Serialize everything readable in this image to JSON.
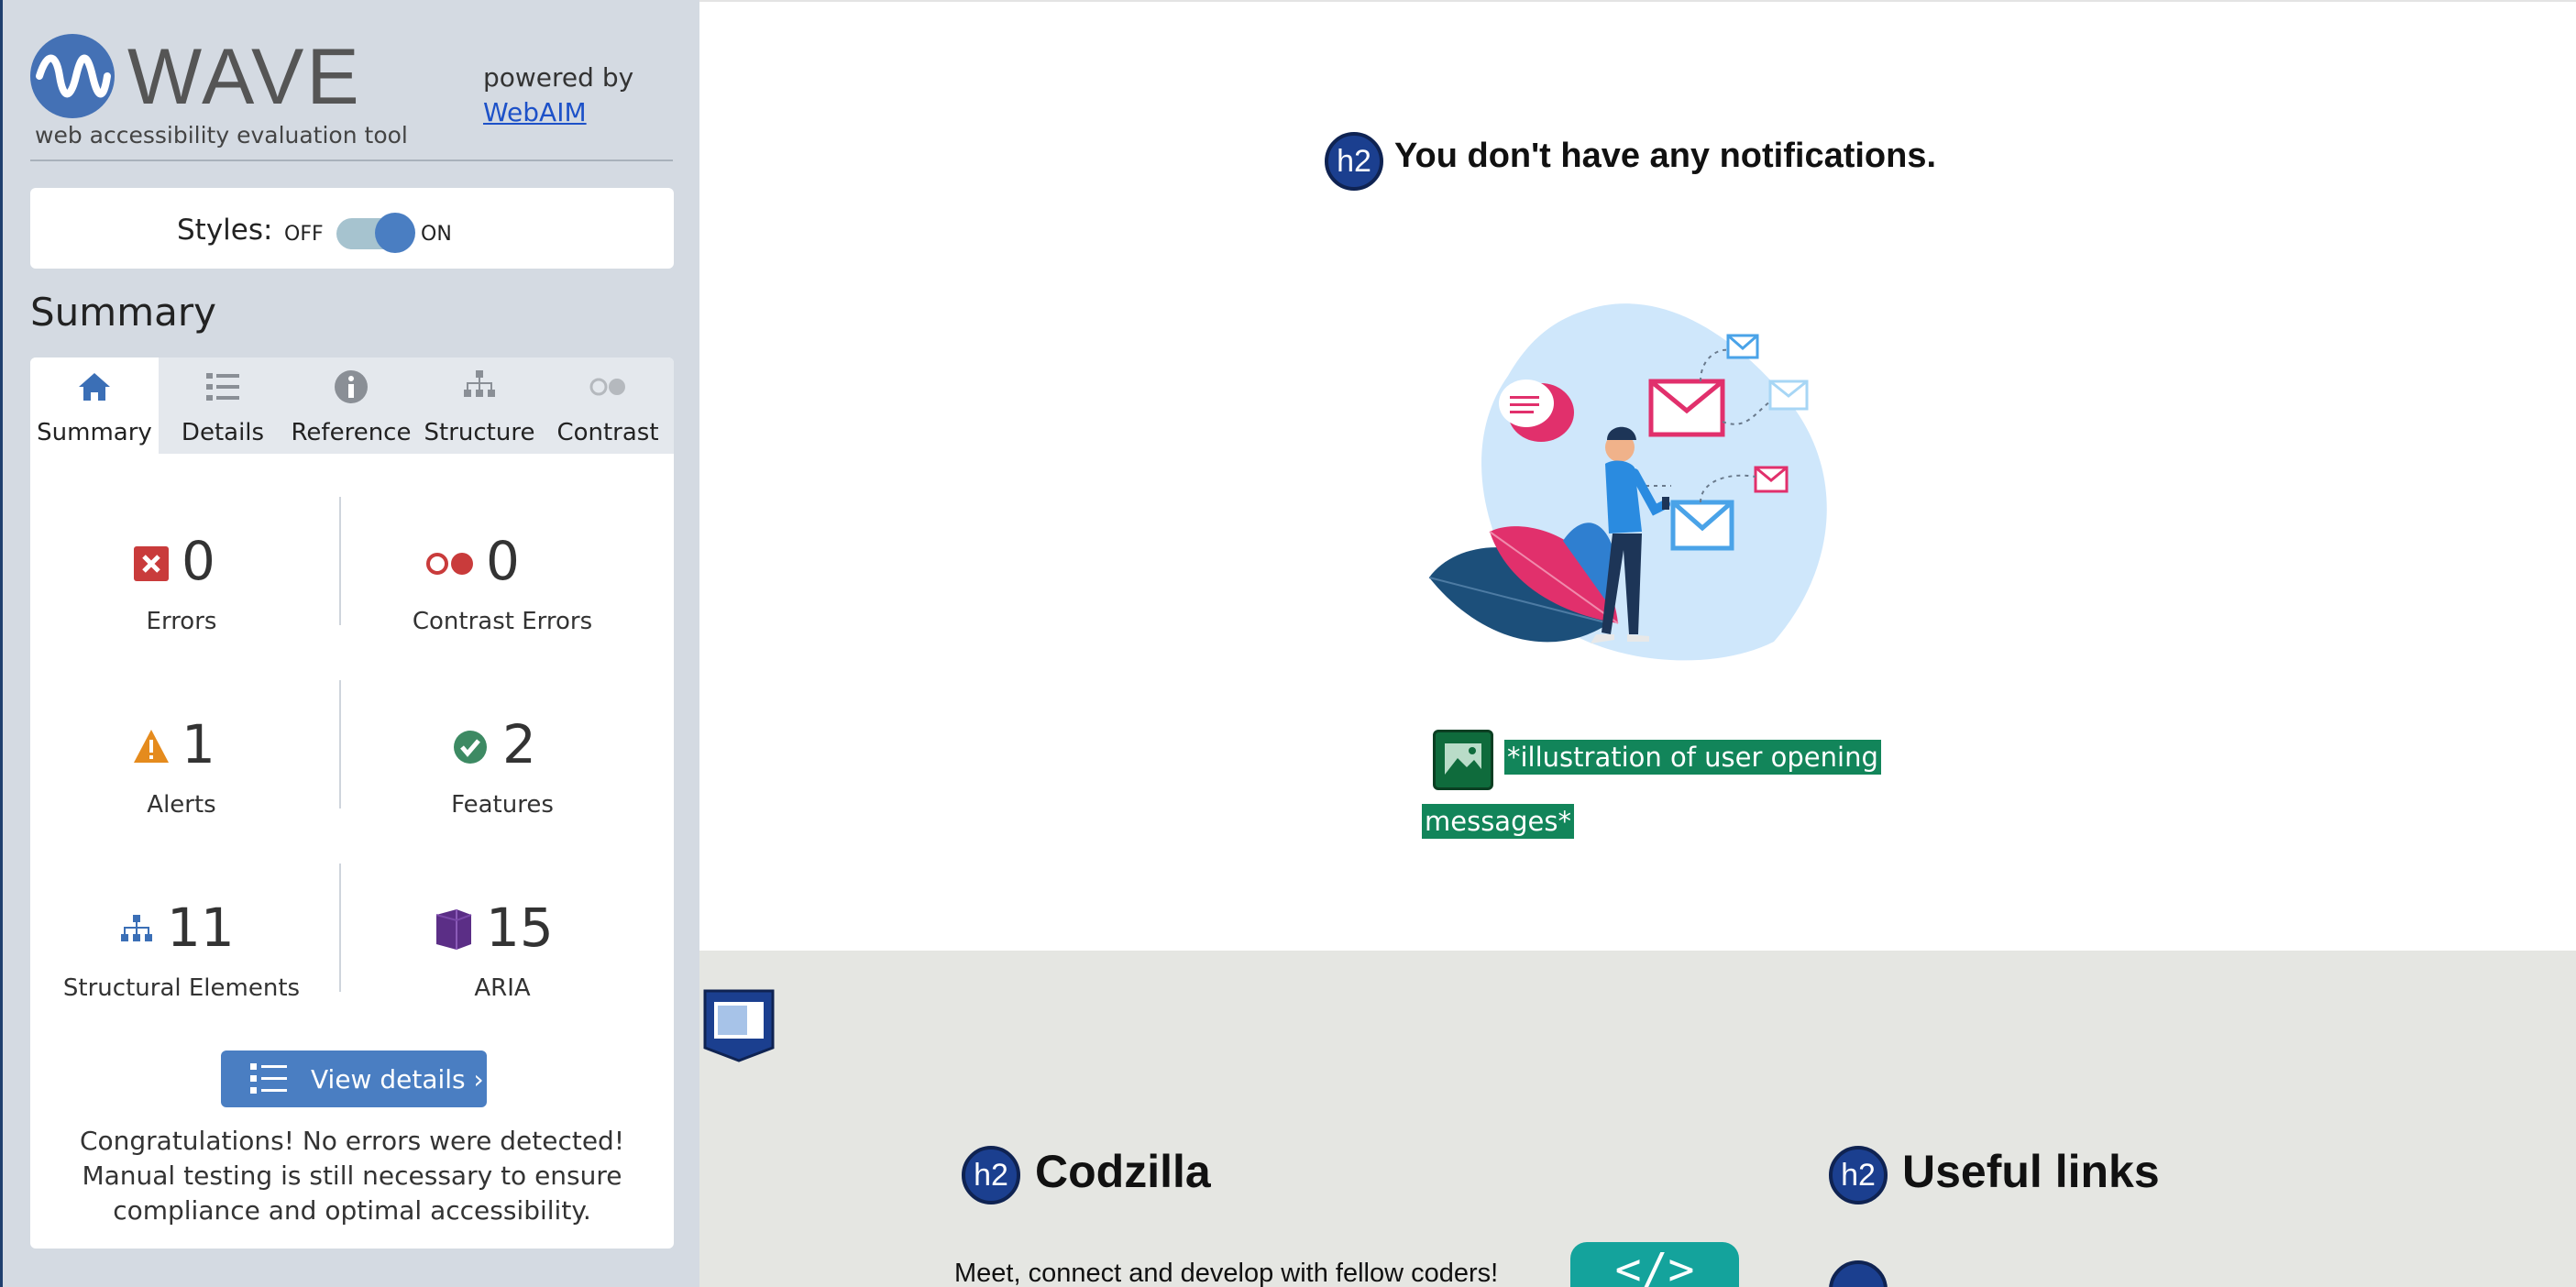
{
  "wave": {
    "logo_word": "WAVE",
    "tagline": "web accessibility evaluation tool",
    "powered_by": "powered by",
    "webaim_link": "WebAIM",
    "styles_label": "Styles:",
    "styles_off": "OFF",
    "styles_on": "ON",
    "styles_state": "on",
    "summary_title": "Summary",
    "tabs": [
      {
        "label": "Summary",
        "icon": "home-icon",
        "active": true
      },
      {
        "label": "Details",
        "icon": "list-icon",
        "active": false
      },
      {
        "label": "Reference",
        "icon": "info-icon",
        "active": false
      },
      {
        "label": "Structure",
        "icon": "structure-icon",
        "active": false
      },
      {
        "label": "Contrast",
        "icon": "contrast-icon",
        "active": false
      }
    ],
    "stats": {
      "errors": {
        "count": "0",
        "label": "Errors",
        "icon": "error-icon",
        "color": "#c93b3b"
      },
      "contrast_errors": {
        "count": "0",
        "label": "Contrast Errors",
        "icon": "contrast-error-icon",
        "color": "#c93b3b"
      },
      "alerts": {
        "count": "1",
        "label": "Alerts",
        "icon": "alert-icon",
        "color": "#e58b1d"
      },
      "features": {
        "count": "2",
        "label": "Features",
        "icon": "feature-icon",
        "color": "#3d8a63"
      },
      "structural": {
        "count": "11",
        "label": "Structural Elements",
        "icon": "structure-icon",
        "color": "#3b6fb6"
      },
      "aria": {
        "count": "15",
        "label": "ARIA",
        "icon": "aria-icon",
        "color": "#5b2e86"
      }
    },
    "view_details": "View details ›",
    "congrats": "Congratulations! No errors were detected! Manual testing is still necessary to ensure compliance and optimal accessibility."
  },
  "page": {
    "h2_badge": "h2",
    "notifications_heading": "You don't have any notifications.",
    "alt_text_line1": "*illustration of user opening",
    "alt_text_line2": "messages*",
    "footer": {
      "codzilla_title": "Codzilla",
      "codzilla_text": "Meet, connect and develop with fellow coders!",
      "code_badge": "</>",
      "useful_links_title": "Useful links"
    }
  },
  "colors": {
    "accent": "#4a7ec2",
    "sidebar_bg": "#d4dae2",
    "footer_bg": "#e5e6e2",
    "alt_bg": "#12855a",
    "h2_badge": "#1b3f8f"
  }
}
